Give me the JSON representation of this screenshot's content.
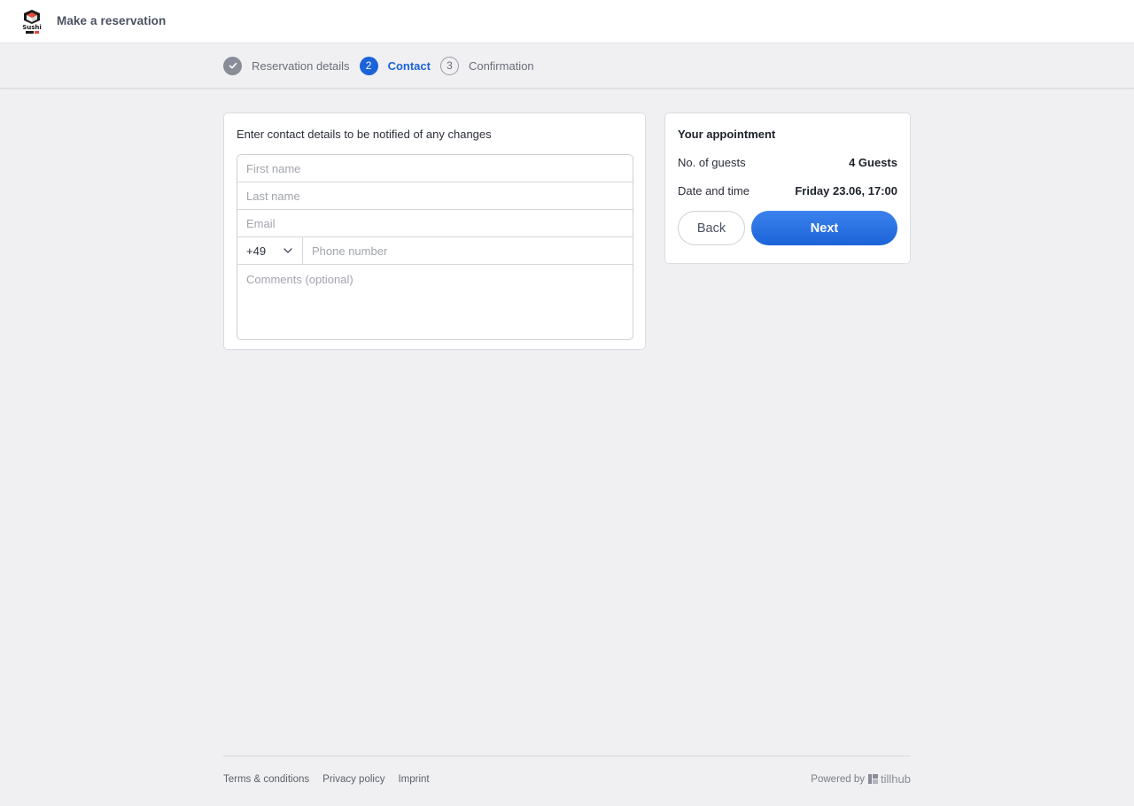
{
  "header": {
    "title": "Make a reservation",
    "logo_icon": "sushi-logo-icon"
  },
  "steps": [
    {
      "number": "",
      "label": "Reservation details",
      "state": "done"
    },
    {
      "number": "2",
      "label": "Contact",
      "state": "active"
    },
    {
      "number": "3",
      "label": "Confirmation",
      "state": "pending"
    }
  ],
  "contact": {
    "heading": "Enter contact details to be notified of any changes",
    "first_name_placeholder": "First name",
    "last_name_placeholder": "Last name",
    "email_placeholder": "Email",
    "country_code": "+49",
    "phone_placeholder": "Phone number",
    "comments_placeholder": "Comments (optional)"
  },
  "appointment": {
    "title": "Your appointment",
    "guests_label": "No. of guests",
    "guests_value": "4 Guests",
    "datetime_label": "Date and time",
    "datetime_value": "Friday 23.06, 17:00",
    "back_label": "Back",
    "next_label": "Next"
  },
  "footer": {
    "links": [
      "Terms & conditions",
      "Privacy policy",
      "Imprint"
    ],
    "powered_by": "Powered by",
    "brand": "tillhub"
  },
  "colors": {
    "accent": "#1b63d8",
    "background": "#f0f0f3"
  }
}
